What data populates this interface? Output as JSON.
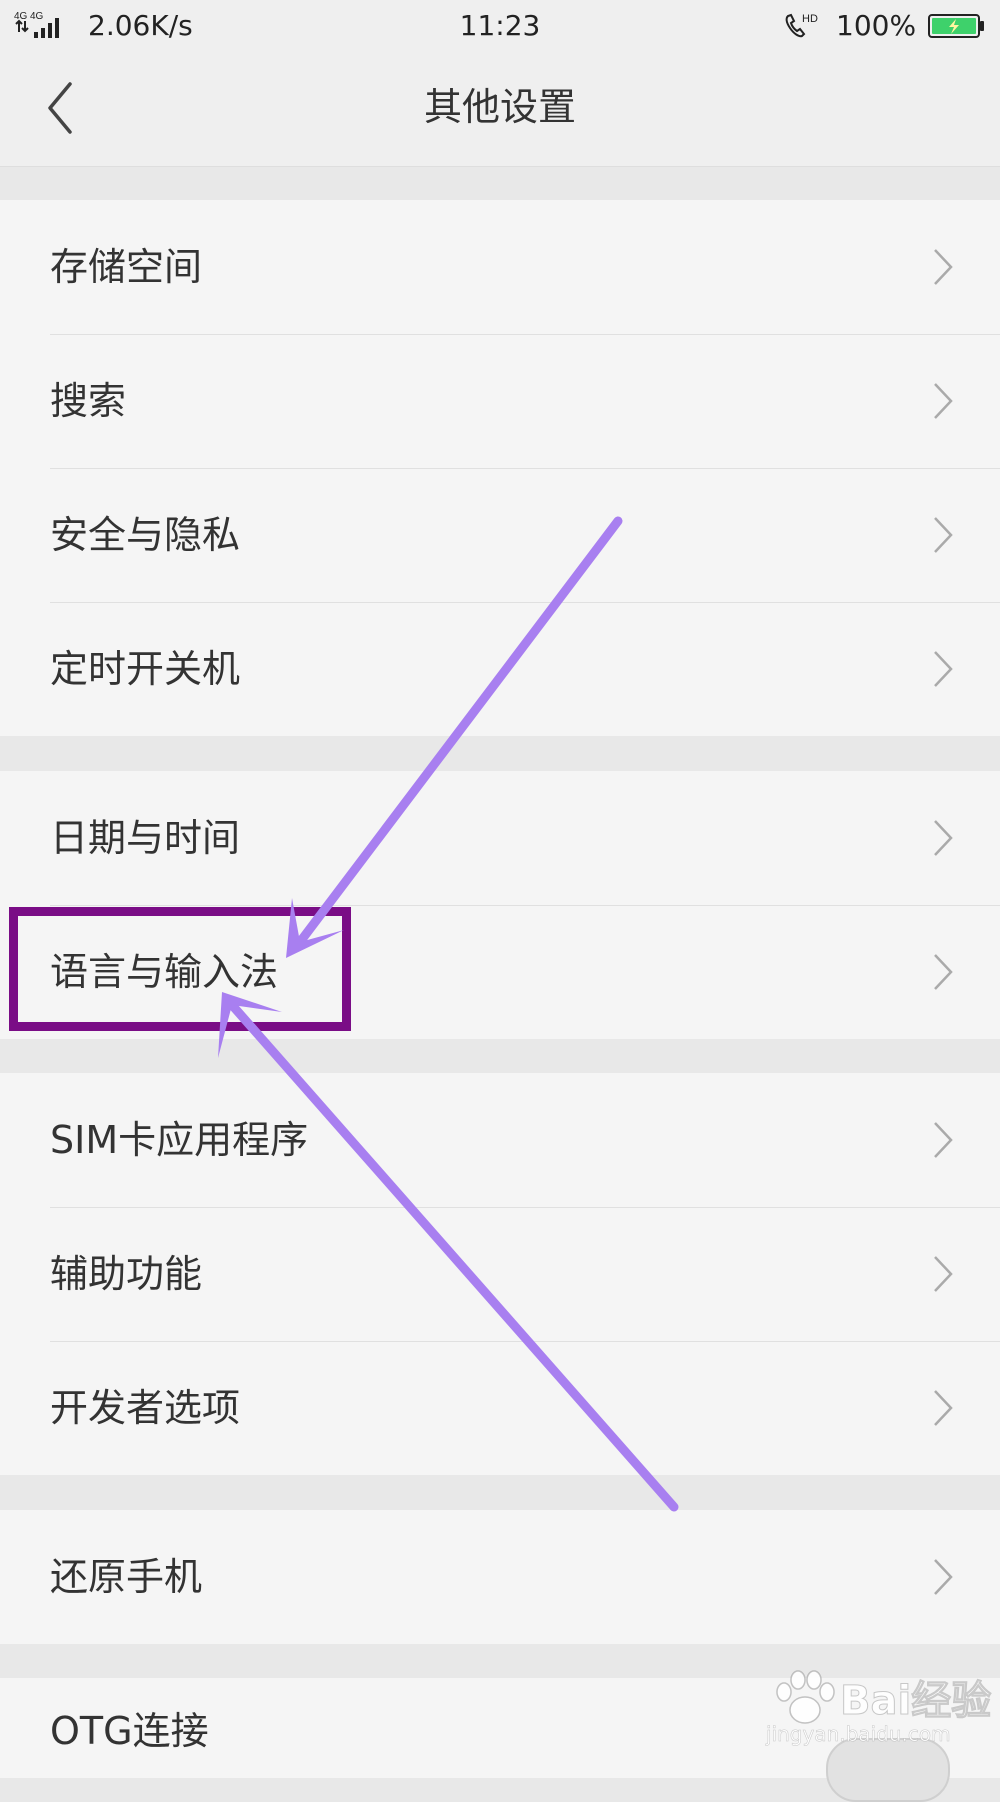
{
  "status_bar": {
    "network": "4G 4G",
    "speed": "2.06K/s",
    "time": "11:23",
    "hd_label": "HD",
    "battery": "100%",
    "battery_color": "#3ed16b"
  },
  "header": {
    "title": "其他设置",
    "back_icon": "chevron-left-icon"
  },
  "groups": [
    {
      "items": [
        {
          "label": "存储空间"
        },
        {
          "label": "搜索"
        },
        {
          "label": "安全与隐私"
        },
        {
          "label": "定时开关机"
        }
      ]
    },
    {
      "items": [
        {
          "label": "日期与时间"
        },
        {
          "label": "语言与输入法"
        }
      ]
    },
    {
      "items": [
        {
          "label": "SIM卡应用程序"
        },
        {
          "label": "辅助功能"
        },
        {
          "label": "开发者选项"
        }
      ]
    },
    {
      "items": [
        {
          "label": "还原手机"
        }
      ]
    },
    {
      "items": [
        {
          "label": "OTG连接"
        }
      ]
    }
  ],
  "annotation": {
    "highlight_color": "#7a0d86",
    "arrow_color": "#a87ff0"
  },
  "watermark": {
    "brand": "Bai",
    "brand_cn": "经验",
    "url": "jingyan.baidu.com"
  }
}
